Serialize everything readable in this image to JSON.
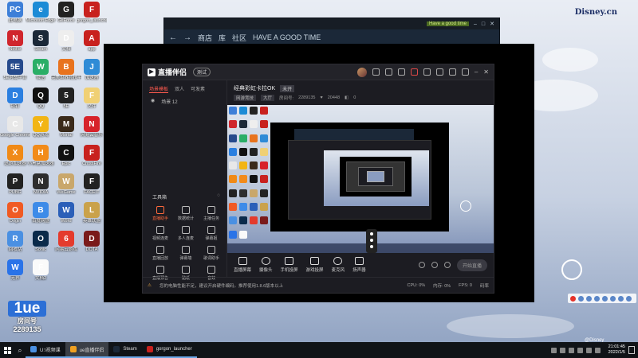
{
  "desktop": {
    "watermark": "Disney.cn",
    "watermark_small": "@Disney",
    "bottom_logo": {
      "big": "1ue",
      "line1": "房间号",
      "line2": "2289135"
    },
    "icons": [
      {
        "label": "此电脑",
        "color": "#3d7fd8",
        "glyph": "PC"
      },
      {
        "label": "Microsoft Edge",
        "color": "#1c8bd6",
        "glyph": "e"
      },
      {
        "label": "GeForce",
        "color": "#222",
        "glyph": "G"
      },
      {
        "label": "gorgon_launcher",
        "color": "#c8211e",
        "glyph": "F"
      },
      {
        "label": "Netflix",
        "color": "#d0262d",
        "glyph": "N"
      },
      {
        "label": "Steam",
        "color": "#1b2838",
        "glyph": "S"
      },
      {
        "label": "文档",
        "color": "#eee",
        "glyph": "D"
      },
      {
        "label": "app",
        "color": "#c8211e",
        "glyph": "A"
      },
      {
        "label": "5E对战平台",
        "color": "#264a8c",
        "glyph": "5E"
      },
      {
        "label": "微信",
        "color": "#2aae67",
        "glyph": "W"
      },
      {
        "label": "完美世界竞技平台",
        "color": "#e8731e",
        "glyph": "B"
      },
      {
        "label": "加速器",
        "color": "#2f8bd6",
        "glyph": "J"
      },
      {
        "label": "钉钉",
        "color": "#2a7fe0",
        "glyph": "D"
      },
      {
        "label": "QQ",
        "color": "#111",
        "glyph": "Q"
      },
      {
        "label": "5E",
        "color": "#222",
        "glyph": "5"
      },
      {
        "label": "文件",
        "color": "#f0d074",
        "glyph": "F"
      },
      {
        "label": "Google Chrome",
        "color": "#e8e8e8",
        "glyph": "C"
      },
      {
        "label": "QQ游戏",
        "color": "#f2b515",
        "glyph": "Y"
      },
      {
        "label": "Mortal",
        "color": "#3a2a1a",
        "glyph": "M"
      },
      {
        "label": "网易云音乐",
        "color": "#d7222a",
        "glyph": "N"
      },
      {
        "label": "迅游加速器",
        "color": "#f08a17",
        "glyph": "X"
      },
      {
        "label": "小黑盒加速器",
        "color": "#f28b1a",
        "glyph": "H"
      },
      {
        "label": "Epic",
        "color": "#111",
        "glyph": "C"
      },
      {
        "label": "CrossFire",
        "color": "#c8211e",
        "glyph": "F"
      },
      {
        "label": "PUBG",
        "color": "#222",
        "glyph": "P"
      },
      {
        "label": "NVIDIA",
        "color": "#2d2d2d",
        "glyph": "N"
      },
      {
        "label": "WeGame",
        "color": "#c9a76b",
        "glyph": "W"
      },
      {
        "label": "FACEIT",
        "color": "#222",
        "glyph": "F"
      },
      {
        "label": "Origin",
        "color": "#f05a23",
        "glyph": "O"
      },
      {
        "label": "百度网盘",
        "color": "#3d8be8",
        "glyph": "B"
      },
      {
        "label": "Word",
        "color": "#2b5fb8",
        "glyph": "W"
      },
      {
        "label": "英雄联盟",
        "color": "#caa24b",
        "glyph": "L"
      },
      {
        "label": "回收站",
        "color": "#4a90e2",
        "glyph": "R"
      },
      {
        "label": "Sonic",
        "color": "#0a2a4a",
        "glyph": "O"
      },
      {
        "label": "网易云游戏",
        "color": "#e43b2d",
        "glyph": "6"
      },
      {
        "label": "DOTA",
        "color": "#7a1a1a",
        "glyph": "D"
      },
      {
        "label": "无界",
        "color": "#2a73e8",
        "glyph": "W"
      },
      {
        "label": "文档2",
        "color": "#fafafa",
        "glyph": "F"
      }
    ]
  },
  "steam": {
    "notification": "Have a good time",
    "nav_back": "←",
    "nav_forward": "→",
    "nav_store": "商店",
    "nav_library": "库",
    "nav_community": "社区",
    "nav_user": "HAVE A GOOD TIME"
  },
  "app": {
    "name": "直播伴侣",
    "version_pill": "测试",
    "tabs": [
      "场景模板",
      "双人",
      "可发素"
    ],
    "scene_label": "场景 12",
    "tools_title": "工具箱",
    "tools": [
      {
        "label": "直播助手",
        "hot": true
      },
      {
        "label": "数据统计",
        "hot": false
      },
      {
        "label": "主播任务",
        "hot": false
      },
      {
        "label": "视频连麦",
        "hot": false
      },
      {
        "label": "多人连麦",
        "hot": false
      },
      {
        "label": "弹幕姬",
        "hot": false
      },
      {
        "label": "直播回放",
        "hot": false
      },
      {
        "label": "弹幕墙",
        "hot": false
      },
      {
        "label": "歌词助手",
        "hot": false
      },
      {
        "label": "直播预告",
        "hot": false
      },
      {
        "label": "贴纸",
        "hot": false
      },
      {
        "label": "音效",
        "hot": false
      }
    ],
    "stream_title": "经典彩虹卡拉OK",
    "stream_tag": "未开",
    "meta": {
      "category": "网游竞技",
      "sub": "大厅",
      "room_label": "房间号:",
      "room": "2289135",
      "fans": "20448",
      "online": "0"
    },
    "controls": [
      {
        "label": "直播屏幕"
      },
      {
        "label": "摄像头"
      },
      {
        "label": "手机投屏"
      },
      {
        "label": "游戏投屏"
      },
      {
        "label": "麦克风"
      },
      {
        "label": "扬声器"
      }
    ],
    "go_live": "开始直播",
    "status": {
      "warning": "您的电脑性能不足，建议开启硬件编码。推荐使用1.8.6版本以上",
      "cpu": "CPU: 0%",
      "memory": "内存: 0%",
      "fps": "FPS: 0",
      "bitrate": "码率"
    }
  },
  "taskbar": {
    "tasks": [
      {
        "label": "U:\\视频课",
        "color": "#4a90e2",
        "active": false
      },
      {
        "label": "ue直播伴侣",
        "color": "#f0a020",
        "active": true
      },
      {
        "label": "Steam",
        "color": "#1b2838",
        "active": false
      },
      {
        "label": "gorgon_launcher",
        "color": "#c8211e",
        "active": false
      }
    ],
    "time": "21:01:45",
    "date": "2022/1/5"
  },
  "colors": {
    "accent": "#ff5a4f",
    "app_bg": "#1c1c22",
    "steam_bg": "#1b2838"
  }
}
